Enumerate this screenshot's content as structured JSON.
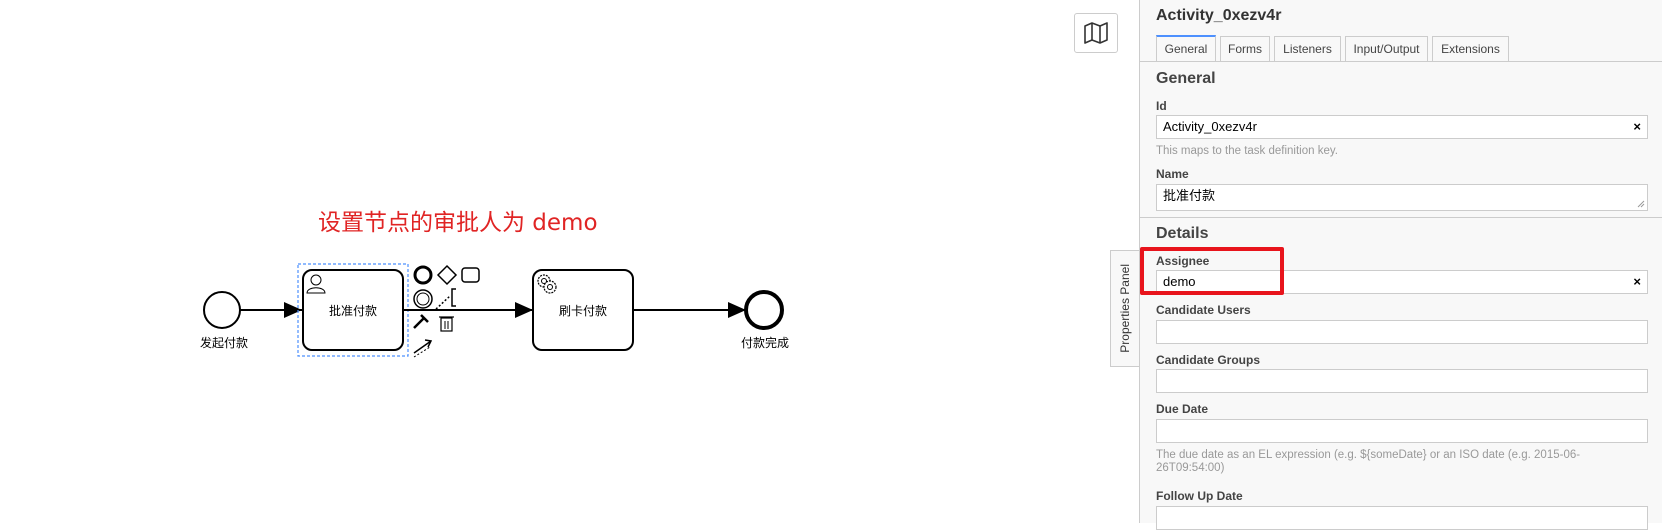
{
  "canvas": {
    "annotation": "设置节点的审批人为 demo",
    "start_event_label": "发起付款",
    "user_task_label": "批准付款",
    "service_task_label": "刷卡付款",
    "end_event_label": "付款完成"
  },
  "map_button": {
    "icon": "map-icon"
  },
  "panel_toggle": {
    "label": "Properties Panel"
  },
  "panel": {
    "title": "Activity_0xezv4r",
    "tabs": [
      "General",
      "Forms",
      "Listeners",
      "Input/Output",
      "Extensions"
    ],
    "active_tab": "General",
    "general_heading": "General",
    "id_label": "Id",
    "id_value": "Activity_0xezv4r",
    "id_hint": "This maps to the task definition key.",
    "name_label": "Name",
    "name_value": "批准付款",
    "details_heading": "Details",
    "assignee_label": "Assignee",
    "assignee_value": "demo",
    "candidate_users_label": "Candidate Users",
    "candidate_users_value": "",
    "candidate_groups_label": "Candidate Groups",
    "candidate_groups_value": "",
    "due_date_label": "Due Date",
    "due_date_value": "",
    "due_date_hint": "The due date as an EL expression (e.g. ${someDate} or an ISO date (e.g. 2015-06-26T09:54:00)",
    "follow_up_label": "Follow Up Date",
    "follow_up_value": "",
    "clear_symbol": "×"
  },
  "colors": {
    "highlight": "#e8141c",
    "annotation": "#e02424",
    "selection": "#4d90fe"
  }
}
